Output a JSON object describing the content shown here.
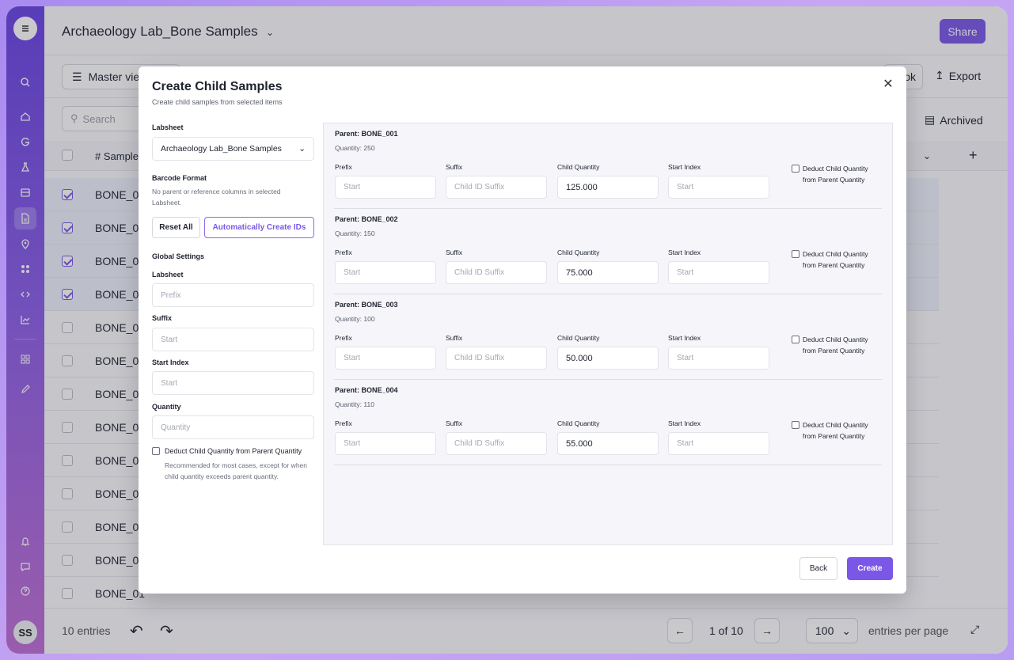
{
  "app": {
    "title": "Archaeology Lab_Bone Samples",
    "share_label": "Share",
    "avatar_initials": "SS",
    "accent_color": "#7b57e8"
  },
  "toolbar": {
    "master_view_label": "Master vie",
    "ok_label": "ok",
    "export_label": "Export",
    "search_placeholder": "Search",
    "archived_label": "Archived"
  },
  "table": {
    "column_header": "Sample",
    "rows": [
      {
        "name": "BONE_00",
        "selected": true
      },
      {
        "name": "BONE_00",
        "selected": true
      },
      {
        "name": "BONE_00",
        "selected": true
      },
      {
        "name": "BONE_00",
        "selected": true
      },
      {
        "name": "BONE_00",
        "selected": false
      },
      {
        "name": "BONE_00",
        "selected": false
      },
      {
        "name": "BONE_00",
        "selected": false
      },
      {
        "name": "BONE_00",
        "selected": false
      },
      {
        "name": "BONE_00",
        "selected": false
      },
      {
        "name": "BONE_00",
        "selected": false
      },
      {
        "name": "BONE_01",
        "selected": false
      },
      {
        "name": "BONE_01",
        "selected": false
      },
      {
        "name": "BONE_01",
        "selected": false
      }
    ]
  },
  "footer": {
    "entries": "10 entries",
    "page_text": "1 of 10",
    "per_page_value": "100",
    "per_page_label": "entries per page"
  },
  "modal": {
    "title": "Create Child Samples",
    "subtitle": "Create child samples from selected items",
    "labsheet_label": "Labsheet",
    "labsheet_value": "Archaeology Lab_Bone Samples",
    "barcode_label": "Barcode Format",
    "barcode_help": "No parent or reference columns in selected Labsheet.",
    "reset_label": "Reset All",
    "auto_label": "Automatically Create IDs",
    "global_label": "Global Settings",
    "g_labsheet_label": "Labsheet",
    "g_labsheet_placeholder": "Prefix",
    "g_suffix_label": "Suffix",
    "g_suffix_placeholder": "Start",
    "g_start_label": "Start Index",
    "g_start_placeholder": "Start",
    "g_qty_label": "Quantity",
    "g_qty_placeholder": "Quantity",
    "g_deduct_label": "Deduct Child Quantity from Parent Quantity",
    "g_deduct_help": "Recommended for most cases, except for when child quantity exceeds parent quantity.",
    "field_labels": {
      "prefix": "Prefix",
      "suffix": "Suffix",
      "child_qty": "Child Quantity",
      "start_index": "Start Index",
      "deduct": "Deduct Child Quantity from Parent Quantity"
    },
    "placeholders": {
      "prefix": "Start",
      "suffix": "Child ID Suffix",
      "start_index": "Start"
    },
    "parents": [
      {
        "title": "Parent: BONE_001",
        "quantity": "Quantity: 250",
        "child_qty": "125.000"
      },
      {
        "title": "Parent: BONE_002",
        "quantity": "Quantity: 150",
        "child_qty": "75.000"
      },
      {
        "title": "Parent: BONE_003",
        "quantity": "Quantity: 100",
        "child_qty": "50.000"
      },
      {
        "title": "Parent: BONE_004",
        "quantity": "Quantity: 110",
        "child_qty": "55.000"
      }
    ],
    "back_label": "Back",
    "create_label": "Create"
  }
}
